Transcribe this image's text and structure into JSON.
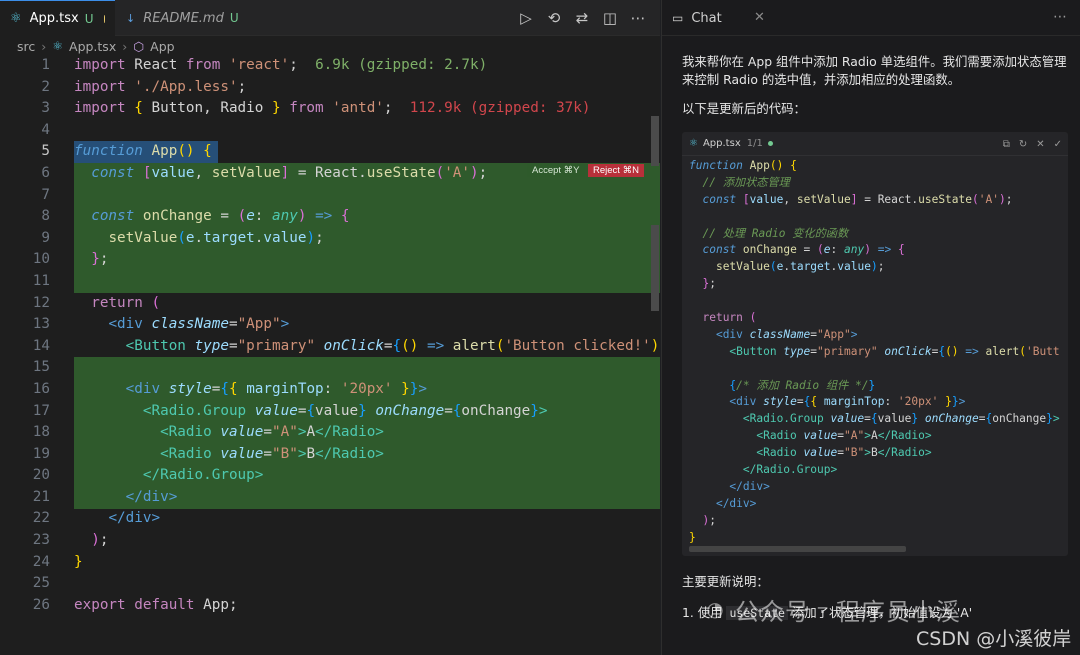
{
  "editor": {
    "tabs": [
      {
        "label": "App.tsx",
        "status": "U"
      },
      {
        "label": "README.md",
        "status": "U"
      }
    ],
    "breadcrumb": [
      "src",
      "App.tsx",
      "App"
    ],
    "line_numbers": [
      "1",
      "2",
      "3",
      "4",
      "5",
      "6",
      "7",
      "8",
      "9",
      "10",
      "11",
      "12",
      "13",
      "14",
      "15",
      "16",
      "17",
      "18",
      "19",
      "20",
      "21",
      "22",
      "23",
      "24",
      "25",
      "26"
    ],
    "import_sizes": {
      "react": "6.9k (gzipped: 2.7k)",
      "antd": "112.9k (gzipped: 37k)"
    },
    "accept_label": "Accept ⌘Y",
    "reject_label": "Reject ⌘N"
  },
  "chat": {
    "tab_label": "Chat",
    "intro": "我来帮你在 App 组件中添加 Radio 单选组件。我们需要添加状态管理来控制 Radio 的选中值，并添加相应的处理函数。",
    "updated_code_heading": "以下是更新后的代码：",
    "code_card": {
      "filename": "App.tsx",
      "count": "1/1"
    },
    "summary_heading": "主要更新说明：",
    "summary_item_1_prefix": "1. 使用 ",
    "summary_item_1_code": "useState",
    "summary_item_1_suffix": " 添加了状态管理，初始值设为 'A'"
  },
  "watermark": {
    "line1": "公众号 · 程序员小溪",
    "line2": "CSDN @小溪彼岸"
  }
}
